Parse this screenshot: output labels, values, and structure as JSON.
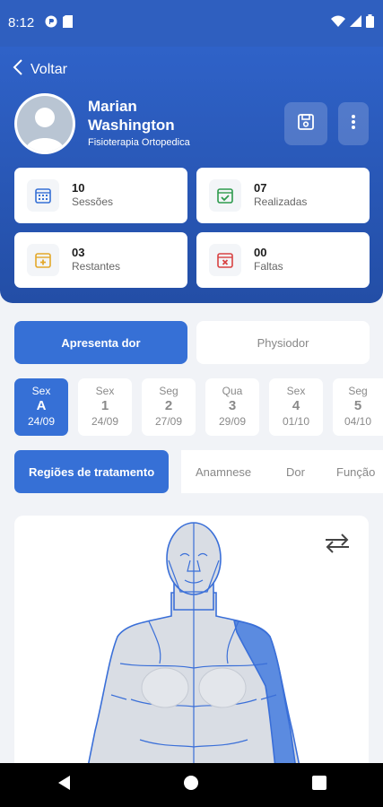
{
  "status_bar": {
    "time": "8:12"
  },
  "header": {
    "back_label": "Voltar",
    "patient_name_line1": "Marian",
    "patient_name_line2": "Washington",
    "specialty": "Fisioterapia Ortopedica",
    "stats": [
      {
        "value": "10",
        "label": "Sessões"
      },
      {
        "value": "07",
        "label": "Realizadas"
      },
      {
        "value": "03",
        "label": "Restantes"
      },
      {
        "value": "00",
        "label": "Faltas"
      }
    ]
  },
  "segments": {
    "left": "Apresenta dor",
    "right": "Physiodor"
  },
  "days": [
    {
      "weekday": "Sex",
      "num": "A",
      "date": "24/09"
    },
    {
      "weekday": "Sex",
      "num": "1",
      "date": "24/09"
    },
    {
      "weekday": "Seg",
      "num": "2",
      "date": "27/09"
    },
    {
      "weekday": "Qua",
      "num": "3",
      "date": "29/09"
    },
    {
      "weekday": "Sex",
      "num": "4",
      "date": "01/10"
    },
    {
      "weekday": "Seg",
      "num": "5",
      "date": "04/10"
    }
  ],
  "treatment_tabs": [
    "Regiões de tratamento",
    "Anamnese",
    "Dor",
    "Função"
  ],
  "colors": {
    "primary": "#3670d6",
    "header": "#2f5fbf",
    "body_fill": "#d9dde4",
    "body_outline": "#3a6fd8",
    "highlight": "#5b8be0"
  },
  "icons": [
    "back-chevron-icon",
    "save-icon",
    "more-vertical-icon",
    "calendar-icon",
    "swap-icon"
  ]
}
